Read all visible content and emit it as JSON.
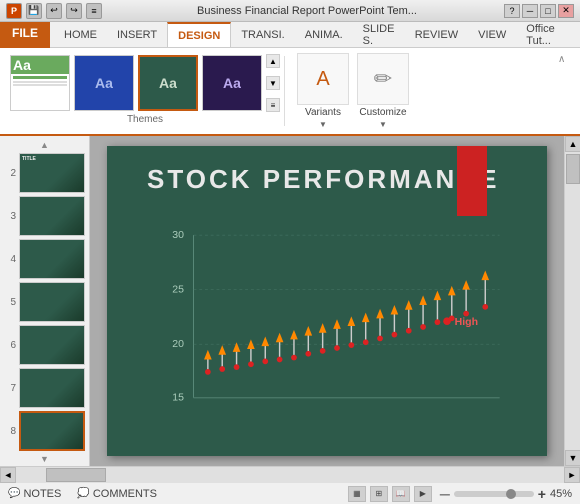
{
  "titlebar": {
    "title": "Business Financial Report PowerPoint Tem...",
    "icons": [
      "save",
      "undo",
      "redo",
      "customize"
    ]
  },
  "ribbon": {
    "file_tab": "FILE",
    "tabs": [
      "HOME",
      "INSERT",
      "DESIGN",
      "TRANSI.",
      "ANIMA.",
      "SLIDE S.",
      "REVIEW",
      "VIEW",
      "Office Tut..."
    ],
    "active_tab": "DESIGN",
    "themes_label": "Themes",
    "variants_label": "Variants",
    "customize_label": "Customize"
  },
  "slide_panel": {
    "slides": [
      {
        "num": "2"
      },
      {
        "num": "3"
      },
      {
        "num": "4"
      },
      {
        "num": "5"
      },
      {
        "num": "6"
      },
      {
        "num": "7"
      },
      {
        "num": "8"
      }
    ]
  },
  "slide": {
    "title": "STOCK PERFORMANCE",
    "chart": {
      "y_labels": [
        "30",
        "25",
        "20",
        "15"
      ],
      "legend_high": "High"
    }
  },
  "statusbar": {
    "notes_label": "NOTES",
    "comments_label": "COMMENTS",
    "zoom": "45%",
    "plus_label": "+"
  }
}
